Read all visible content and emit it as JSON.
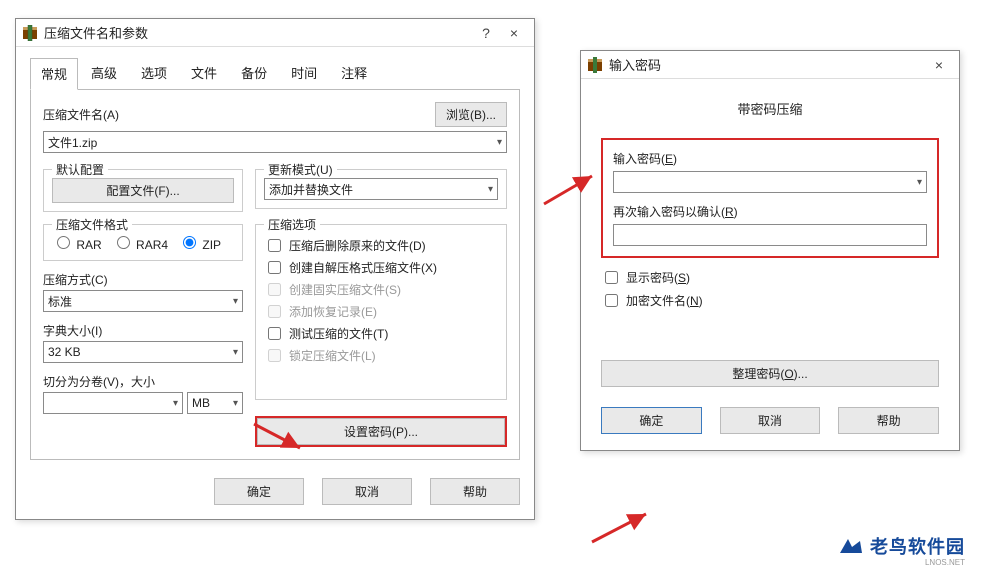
{
  "dialog1": {
    "title": "压缩文件名和参数",
    "help": "?",
    "close": "×",
    "tabs": [
      "常规",
      "高级",
      "选项",
      "文件",
      "备份",
      "时间",
      "注释"
    ],
    "archive_label": "压缩文件名(A)",
    "browse_btn": "浏览(B)...",
    "archive_value": "文件1.zip",
    "default_cfg_label": "默认配置",
    "profiles_btn": "配置文件(F)...",
    "update_label": "更新模式(U)",
    "update_value": "添加并替换文件",
    "fmt_label": "压缩文件格式",
    "fmt_rar": "RAR",
    "fmt_rar4": "RAR4",
    "fmt_zip": "ZIP",
    "method_label": "压缩方式(C)",
    "method_value": "标准",
    "dict_label": "字典大小(I)",
    "dict_value": "32 KB",
    "split_label": "切分为分卷(V)，大小",
    "split_unit": "MB",
    "opts_label": "压缩选项",
    "opt_delete": "压缩后删除原来的文件(D)",
    "opt_sfx": "创建自解压格式压缩文件(X)",
    "opt_solid": "创建固实压缩文件(S)",
    "opt_recover": "添加恢复记录(E)",
    "opt_test": "测试压缩的文件(T)",
    "opt_lock": "锁定压缩文件(L)",
    "set_pwd_btn": "设置密码(P)...",
    "ok": "确定",
    "cancel": "取消",
    "help_btn": "帮助"
  },
  "dialog2": {
    "title": "输入密码",
    "close": "×",
    "heading": "带密码压缩",
    "pwd_label_pre": "输入密码(",
    "pwd_label_u": "E",
    "pwd_label_post": ")",
    "confirm_label_pre": "再次输入密码以确认(",
    "confirm_label_u": "R",
    "confirm_label_post": ")",
    "show_pre": "显示密码(",
    "show_u": "S",
    "show_post": ")",
    "encrypt_pre": "加密文件名(",
    "encrypt_u": "N",
    "encrypt_post": ")",
    "organize_pre": "整理密码(",
    "organize_u": "O",
    "organize_post": ")...",
    "ok": "确定",
    "cancel": "取消",
    "help": "帮助"
  },
  "watermark": {
    "text": "老鸟软件园",
    "sub": "LNOS.NET"
  }
}
